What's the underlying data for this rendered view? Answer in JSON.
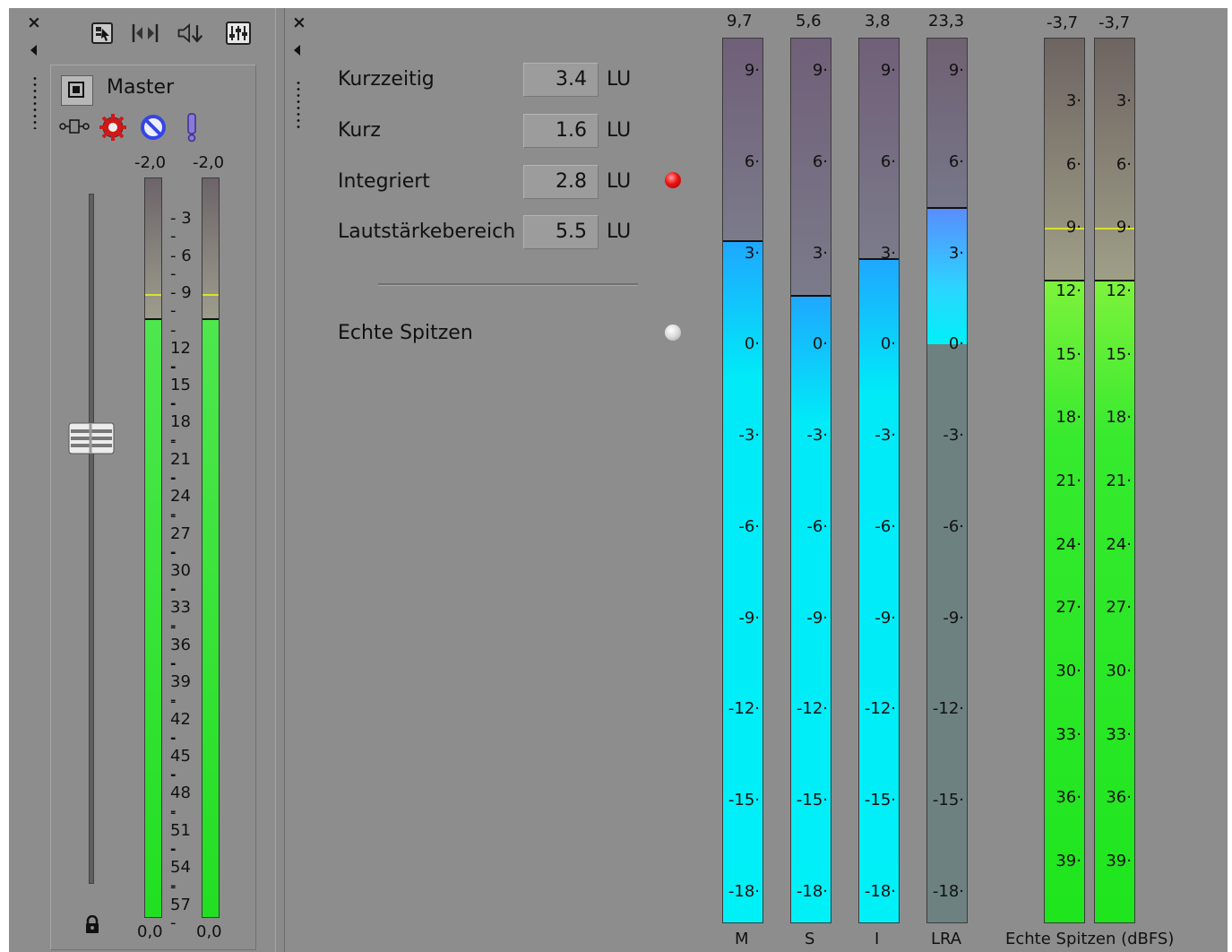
{
  "window": {
    "close_glyph": "×",
    "colors": {
      "panel": "#8d8d8d",
      "text": "#111111"
    }
  },
  "mixer": {
    "toolbar_icons": [
      "insert-icon",
      "bus-icon",
      "downmix-icon",
      "mixer-icon"
    ],
    "track_name": "Master",
    "track_icons": [
      "automation-icon",
      "fx-icon",
      "mute-icon",
      "solo-icon"
    ],
    "peak_left": "-2,0",
    "peak_right": "-2,0",
    "level_left": "0,0",
    "level_right": "0,0",
    "fader_level": 0.355,
    "meter_fill_top_db": -11.0,
    "meter_hold_db": -9.0,
    "meter_scale": [
      "3",
      "6",
      "9",
      "12",
      "15",
      "18",
      "21",
      "24",
      "27",
      "30",
      "33",
      "36",
      "39",
      "42",
      "45",
      "48",
      "51",
      "54",
      "57"
    ],
    "lock_icon": "lock-icon",
    "colors": {
      "meter_fill": "#33e233",
      "meter_top": "#6e6a6e",
      "hold_line": "#d9e12a"
    }
  },
  "loudness": {
    "rows": [
      {
        "label": "Kurzzeitig",
        "value": "3.4",
        "unit": "LU"
      },
      {
        "label": "Kurz",
        "value": "1.6",
        "unit": "LU"
      },
      {
        "label": "Integriert",
        "value": "2.8",
        "unit": "LU",
        "indicator": "red"
      },
      {
        "label": "Lautstärkebereich",
        "value": "5.5",
        "unit": "LU"
      }
    ],
    "true_peak_label": "Echte Spitzen",
    "true_peak_indicator": "grey",
    "meters": [
      {
        "label": "M",
        "peak": "9,7",
        "value": 3.4
      },
      {
        "label": "S",
        "peak": "5,6",
        "value": 1.6
      },
      {
        "label": "I",
        "peak": "3,8",
        "value": 2.8
      },
      {
        "label": "LRA",
        "peak": "23,3",
        "value": 4.5,
        "fill_from": 0.0
      }
    ],
    "lu_scale": [
      "9",
      "6",
      "3",
      "0",
      "-3",
      "-6",
      "-9",
      "-12",
      "-15",
      "-18"
    ],
    "true_peak_meters": [
      {
        "peak": "-3,7",
        "value_db": -11.5
      },
      {
        "peak": "-3,7",
        "value_db": -11.5
      }
    ],
    "tp_scale": [
      "3",
      "6",
      "9",
      "12",
      "15",
      "18",
      "21",
      "24",
      "27",
      "30",
      "33",
      "36",
      "39"
    ],
    "tp_hold_db": -9.0,
    "tp_caption": "Echte Spitzen (dBFS)",
    "colors": {
      "lu_fill": "#00f0f8",
      "lu_top": "#706279",
      "lra_bottom": "#6d8181",
      "tp_fill": "#1ee51e",
      "red": "#ee1111"
    }
  }
}
